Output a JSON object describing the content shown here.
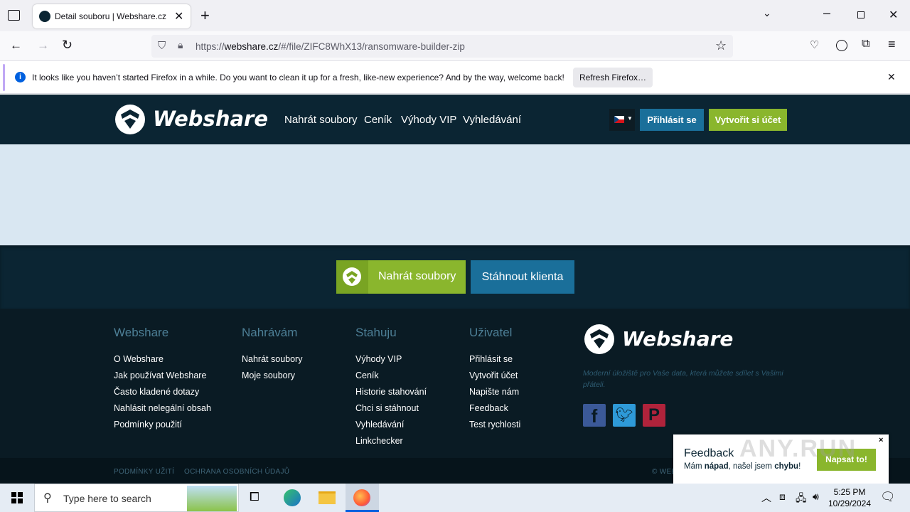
{
  "browser": {
    "tab_title": "Detail souboru | Webshare.cz - W",
    "url_prefix": "https://",
    "url_domain": "webshare.cz",
    "url_path": "/#/file/ZIFC8WhX13/ransomware-builder-zip",
    "notification_text": "It looks like you haven’t started Firefox in a while. Do you want to clean it up for a fresh, like-new experience? And by the way, welcome back!",
    "refresh_label": "Refresh Firefox…"
  },
  "header": {
    "logo": "Webshare",
    "nav": [
      "Nahrát soubory",
      "Ceník",
      "Výhody VIP",
      "Vyhledávání"
    ],
    "login": "Přihlásit se",
    "signup": "Vytvořit si účet"
  },
  "cta": {
    "upload": "Nahrát soubory",
    "client": "Stáhnout klienta"
  },
  "footer": {
    "columns": [
      {
        "title": "Webshare",
        "links": [
          "O Webshare",
          "Jak používat Webshare",
          "Často kladené dotazy",
          "Nahlásit nelegální obsah",
          "Podmínky použití"
        ]
      },
      {
        "title": "Nahrávám",
        "links": [
          "Nahrát soubory",
          "Moje soubory"
        ]
      },
      {
        "title": "Stahuju",
        "links": [
          "Výhody VIP",
          "Ceník",
          "Historie stahování",
          "Chci si stáhnout",
          "Vyhledávání",
          "Linkchecker"
        ]
      },
      {
        "title": "Uživatel",
        "links": [
          "Přihlásit se",
          "Vytvořit účet",
          "Napište nám",
          "Feedback",
          "Test rychlosti"
        ]
      }
    ],
    "logo": "Webshare",
    "tagline": "Moderní úložiště pro Vaše data, která můžete sdílet s Vašimi přáteli.",
    "bottom_links": [
      "PODMÍNKY UŽITÍ",
      "OCHRANA OSOBNÍCH ÚDAJŮ"
    ],
    "copyright": "© WEB"
  },
  "feedback": {
    "title": "Feedback",
    "sub_pre": "Mám ",
    "sub_bold1": "nápad",
    "sub_mid": ", našel jsem ",
    "sub_bold2": "chybu",
    "sub_end": "!",
    "button": "Napsat to!",
    "close": "×"
  },
  "watermark": "ANY.RUN",
  "taskbar": {
    "search_placeholder": "Type here to search",
    "time": "5:25 PM",
    "date": "10/29/2024"
  },
  "colors": {
    "header_bg": "#0b2533",
    "accent_green": "#8ab62d",
    "accent_blue": "#1a6f9a",
    "content_bg": "#d9e7f2"
  }
}
